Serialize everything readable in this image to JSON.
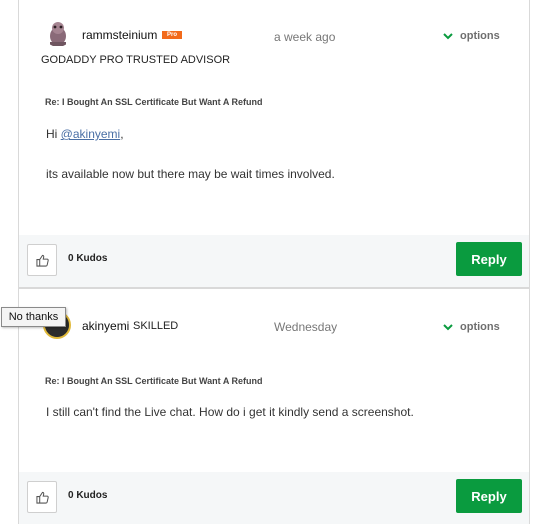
{
  "posts": [
    {
      "username": "rammsteinium",
      "badge": "Pro",
      "rank": "GODADDY PRO TRUSTED ADVISOR",
      "timestamp": "a week ago",
      "options_label": "options",
      "subject": "Re: I Bought An SSL Certificate But Want A Refund",
      "greeting": "Hi ",
      "mention": "@akinyemi",
      "greeting_end": ",",
      "body": "its available now but there may be wait times involved.",
      "kudos": "0 Kudos",
      "reply_label": "Reply"
    },
    {
      "username": "akinyemi",
      "rank": "SKILLED",
      "timestamp": "Wednesday",
      "options_label": "options",
      "subject": "Re: I Bought An SSL Certificate But Want A Refund",
      "body": "I still can't find the Live chat. How do i get it kindly send a screenshot.",
      "kudos": "0 Kudos",
      "reply_label": "Reply"
    }
  ],
  "tooltip": "No thanks",
  "icons": {
    "options": "chevron-down-icon",
    "kudo": "thumbs-up-icon"
  },
  "colors": {
    "accent_green": "#0a9b3f",
    "pro_badge": "#f26a1b",
    "mention_link": "#4a6fa5"
  }
}
